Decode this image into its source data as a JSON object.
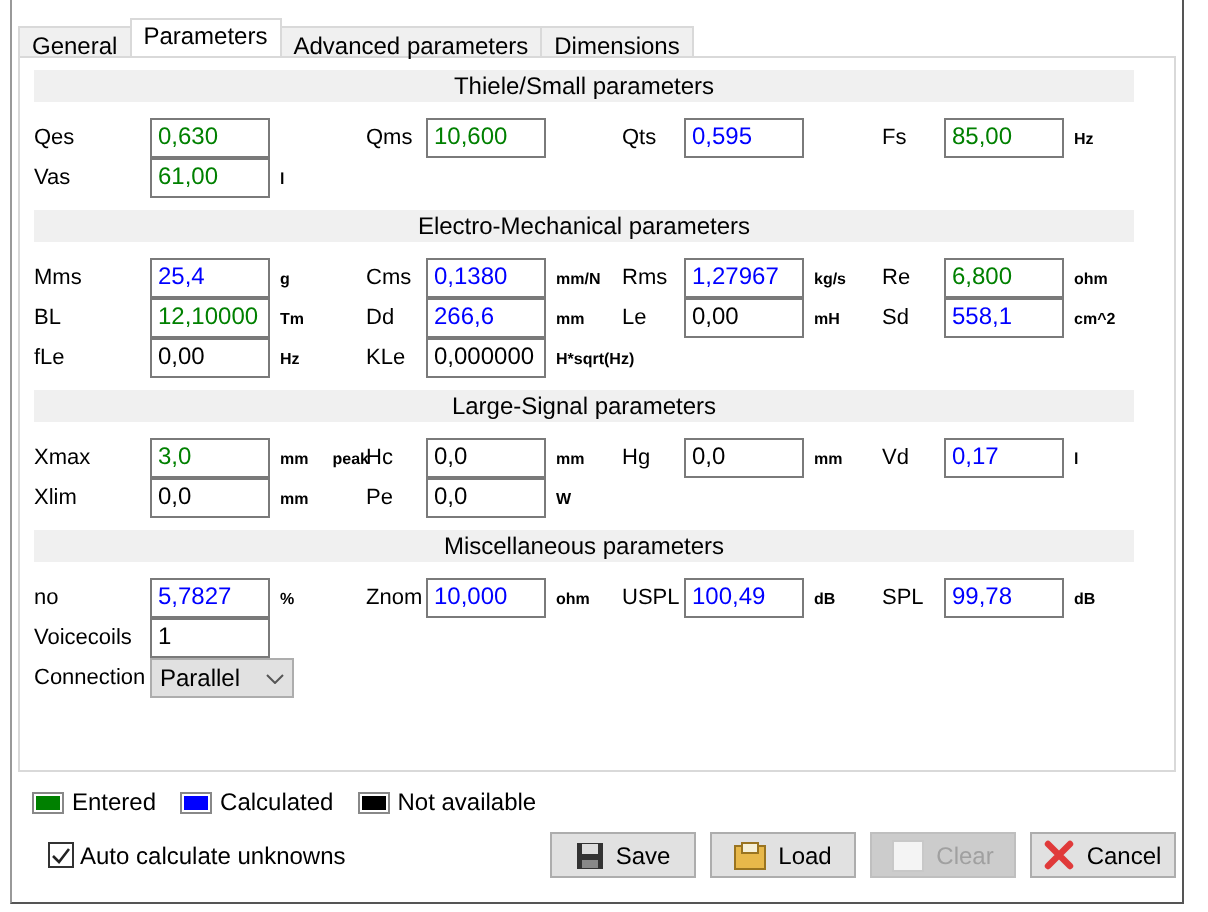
{
  "tabs": [
    {
      "label": "General",
      "selected": false
    },
    {
      "label": "Parameters",
      "selected": true
    },
    {
      "label": "Advanced parameters",
      "selected": false
    },
    {
      "label": "Dimensions",
      "selected": false
    }
  ],
  "sections": [
    {
      "title": "Thiele/Small parameters",
      "rows": [
        [
          {
            "label": "Qes",
            "value": "0,630",
            "color": "#008000"
          },
          {
            "label": "Qms",
            "value": "10,600",
            "color": "#008000"
          },
          {
            "label": "Qts",
            "value": "0,595",
            "color": "#0000ff"
          },
          {
            "label": "Fs",
            "value": "85,00",
            "color": "#008000",
            "unit": "Hz"
          }
        ],
        [
          {
            "label": "Vas",
            "value": "61,00",
            "color": "#008000",
            "unit": "l"
          },
          null,
          null,
          null
        ]
      ]
    },
    {
      "title": "Electro-Mechanical parameters",
      "rows": [
        [
          {
            "label": "Mms",
            "value": "25,4",
            "color": "#0000ff",
            "unit": "g"
          },
          {
            "label": "Cms",
            "value": "0,1380",
            "color": "#0000ff",
            "unit": "mm/N"
          },
          {
            "label": "Rms",
            "value": "1,27967",
            "color": "#0000ff",
            "unit": "kg/s"
          },
          {
            "label": "Re",
            "value": "6,800",
            "color": "#008000",
            "unit": "ohm"
          }
        ],
        [
          {
            "label": "BL",
            "value": "12,10000",
            "color": "#008000",
            "unit": "Tm"
          },
          {
            "label": "Dd",
            "value": "266,6",
            "color": "#0000ff",
            "unit": "mm"
          },
          {
            "label": "Le",
            "value": "0,00",
            "color": "#000000",
            "unit": "mH"
          },
          {
            "label": "Sd",
            "value": "558,1",
            "color": "#0000ff",
            "unit": "cm^2"
          }
        ],
        [
          {
            "label": "fLe",
            "value": "0,00",
            "color": "#000000",
            "unit": "Hz"
          },
          {
            "label": "KLe",
            "value": "0,000000",
            "color": "#000000",
            "unit": "H*sqrt(Hz)"
          },
          null,
          null
        ]
      ]
    },
    {
      "title": "Large-Signal parameters",
      "rows": [
        [
          {
            "label": "Xmax",
            "value": "3,0",
            "color": "#008000",
            "unit": "mm",
            "note": "peak"
          },
          {
            "label": "Hc",
            "value": "0,0",
            "color": "#000000",
            "unit": "mm"
          },
          {
            "label": "Hg",
            "value": "0,0",
            "color": "#000000",
            "unit": "mm"
          },
          {
            "label": "Vd",
            "value": "0,17",
            "color": "#0000ff",
            "unit": "l"
          }
        ],
        [
          {
            "label": "Xlim",
            "value": "0,0",
            "color": "#000000",
            "unit": "mm"
          },
          {
            "label": "Pe",
            "value": "0,0",
            "color": "#000000",
            "unit": "W"
          },
          null,
          null
        ]
      ]
    },
    {
      "title": "Miscellaneous parameters",
      "rows": [
        [
          {
            "label": "no",
            "value": "5,7827",
            "color": "#0000ff",
            "unit": "%"
          },
          {
            "label": "Znom",
            "value": "10,000",
            "color": "#0000ff",
            "unit": "ohm"
          },
          {
            "label": "USPL",
            "value": "100,49",
            "color": "#0000ff",
            "unit": "dB"
          },
          {
            "label": "SPL",
            "value": "99,78",
            "color": "#0000ff",
            "unit": "dB"
          }
        ],
        [
          {
            "label": "Voicecoils",
            "value": "1",
            "color": "#000000"
          },
          null,
          null,
          null
        ],
        [
          {
            "label": "Connection",
            "value": "Parallel",
            "kind": "dropdown"
          },
          null,
          null,
          null
        ]
      ]
    }
  ],
  "legend": [
    {
      "label": "Entered",
      "color": "#008000"
    },
    {
      "label": "Calculated",
      "color": "#0000ff"
    },
    {
      "label": "Not available",
      "color": "#000000"
    }
  ],
  "auto_calculate": {
    "label": "Auto calculate unknowns",
    "checked": true
  },
  "buttons": [
    {
      "label": "Save",
      "kind": "save",
      "disabled": false
    },
    {
      "label": "Load",
      "kind": "load",
      "disabled": false
    },
    {
      "label": "Clear",
      "kind": "clear",
      "disabled": true
    },
    {
      "label": "Cancel",
      "kind": "cancel",
      "disabled": false
    }
  ]
}
